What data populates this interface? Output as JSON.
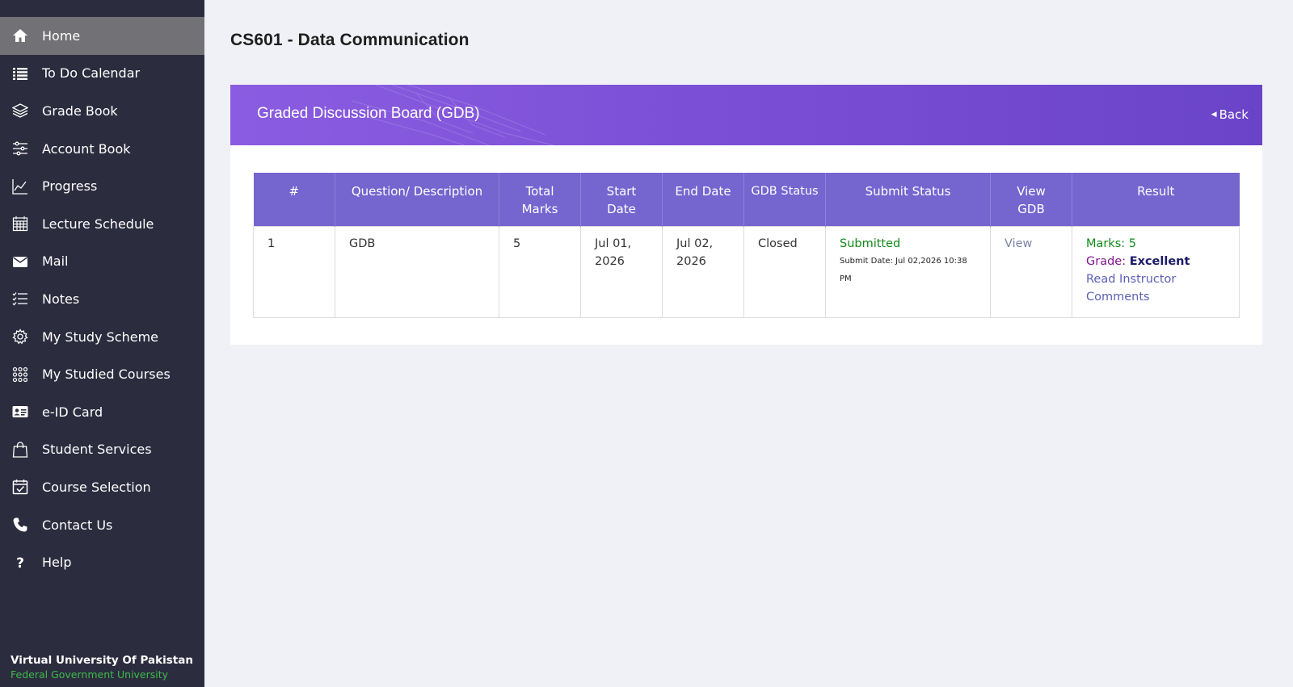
{
  "sidebar": {
    "items": [
      {
        "label": "Home",
        "icon": "home-icon",
        "active": true
      },
      {
        "label": "To Do Calendar",
        "icon": "list-icon"
      },
      {
        "label": "Grade Book",
        "icon": "layers-icon"
      },
      {
        "label": "Account Book",
        "icon": "sliders-icon"
      },
      {
        "label": "Progress",
        "icon": "chart-line-icon"
      },
      {
        "label": "Lecture Schedule",
        "icon": "calendar-grid-icon"
      },
      {
        "label": "Mail",
        "icon": "envelope-icon"
      },
      {
        "label": "Notes",
        "icon": "checklist-icon"
      },
      {
        "label": "My Study Scheme",
        "icon": "gear-icon"
      },
      {
        "label": "My Studied Courses",
        "icon": "dots-grid-icon"
      },
      {
        "label": "e-ID Card",
        "icon": "id-card-icon"
      },
      {
        "label": "Student Services",
        "icon": "shopping-bag-icon"
      },
      {
        "label": "Course Selection",
        "icon": "calendar-check-icon"
      },
      {
        "label": "Contact Us",
        "icon": "phone-icon"
      },
      {
        "label": "Help",
        "icon": "question-icon"
      }
    ],
    "brand_title": "Virtual University Of Pakistan",
    "brand_subtitle": "Federal Government University"
  },
  "main": {
    "page_title": "CS601 - Data Communication",
    "card_title": "Graded Discussion Board (GDB)",
    "back_label": "Back",
    "table": {
      "headers": [
        "#",
        "Question/ Description",
        "Total Marks",
        "Start Date",
        "End Date",
        "GDB Status",
        "Submit Status",
        "View GDB",
        "Result"
      ],
      "rows": [
        {
          "index": "1",
          "description": "GDB",
          "total_marks": "5",
          "start_date": "Jul 01, 2026",
          "end_date": "Jul 02, 2026",
          "gdb_status": "Closed",
          "submit_status": "Submitted",
          "submit_date": "Submit Date: Jul 02,2026 10:38 PM",
          "view_label": "View",
          "marks": "Marks: 5",
          "grade_label": "Grade:",
          "grade_value": "Excellent",
          "comments_label": "Read Instructor Comments"
        }
      ]
    }
  },
  "colors": {
    "sidebar_bg": "#2c2c3f",
    "sidebar_active": "#727276",
    "header_purple": "#7c50d6",
    "table_header": "#7465cf",
    "green": "#118a1a",
    "red": "#d42525"
  }
}
